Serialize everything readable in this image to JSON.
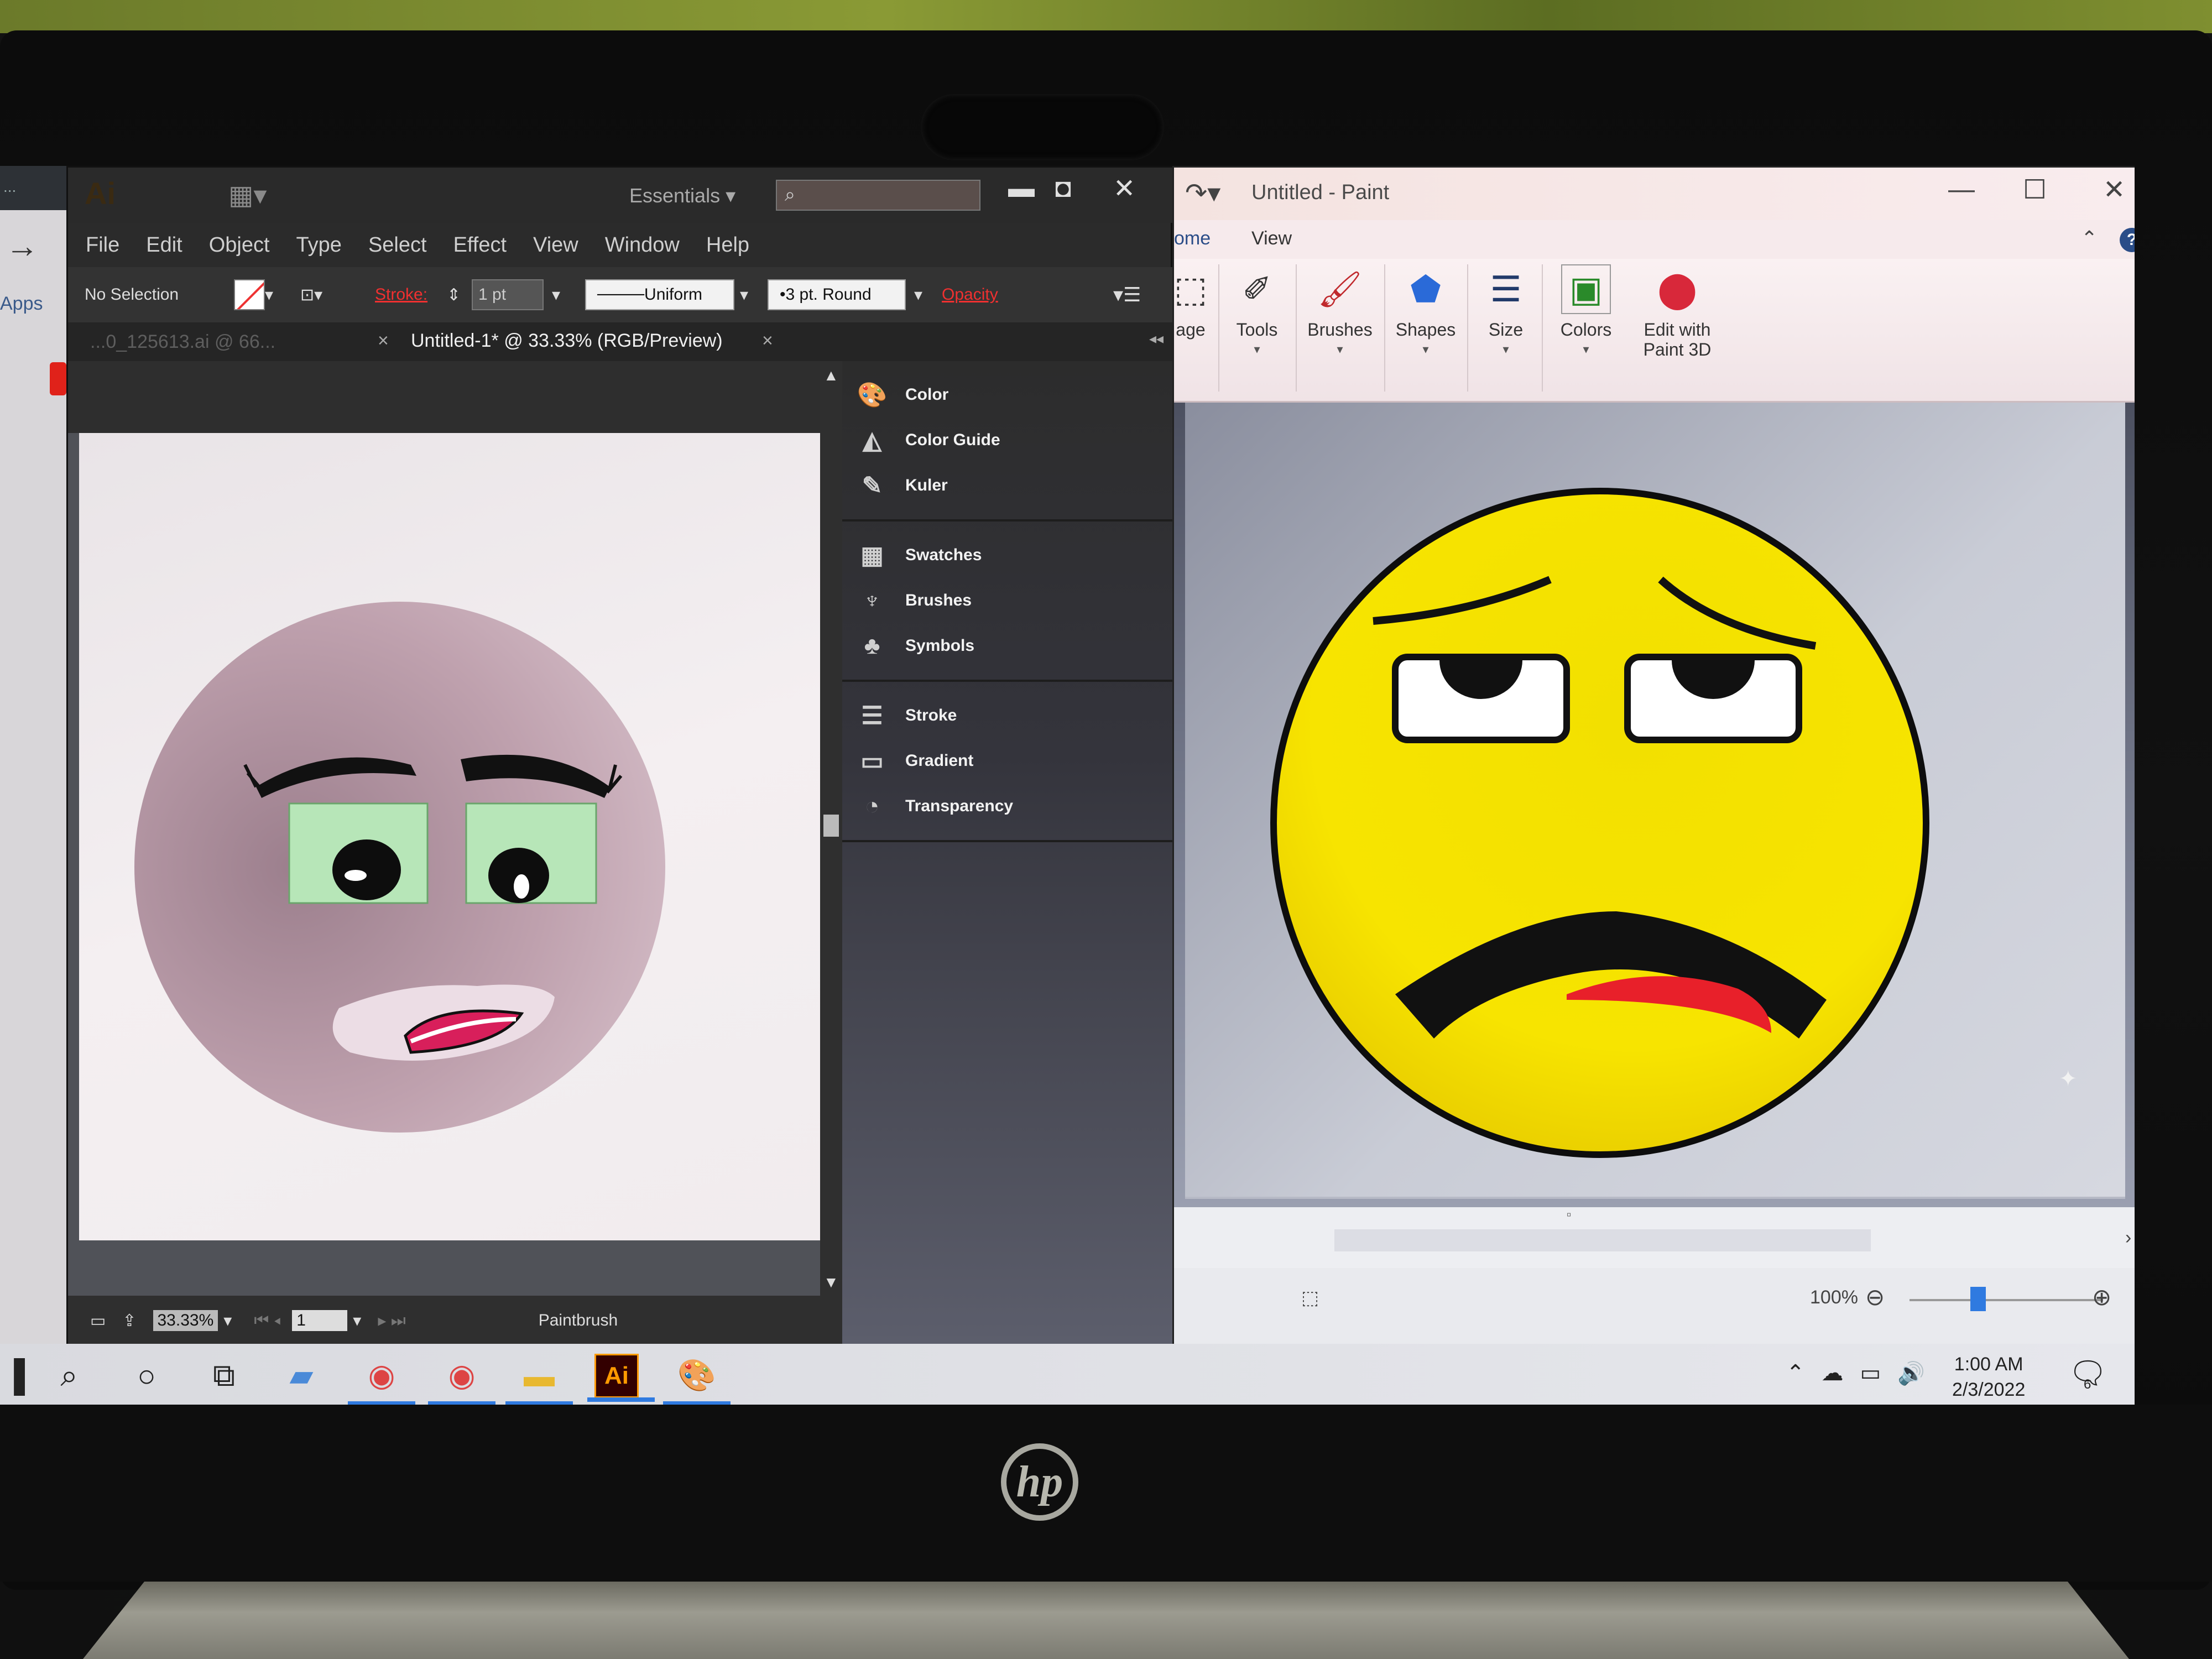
{
  "illustrator": {
    "app_logo": "Ai",
    "workspace": "Essentials",
    "workspace_arrow": "▾",
    "menu": [
      "File",
      "Edit",
      "Object",
      "Type",
      "Select",
      "Effect",
      "View",
      "Window",
      "Help"
    ],
    "control": {
      "selection": "No Selection",
      "stroke_label": "Stroke:",
      "stroke_value": "1 pt",
      "profile": "Uniform",
      "brush": "3 pt. Round",
      "opacity_label": "Opacity"
    },
    "tabs": {
      "inactive": "...0_125613.ai @ 66...",
      "active": "Untitled-1* @ 33.33% (RGB/Preview)"
    },
    "panels": [
      {
        "group": [
          {
            "label": "Color",
            "icon": "palette-icon"
          },
          {
            "label": "Color Guide",
            "icon": "color-guide-icon"
          },
          {
            "label": "Kuler",
            "icon": "kuler-icon"
          }
        ]
      },
      {
        "group": [
          {
            "label": "Swatches",
            "icon": "swatches-grid-icon"
          },
          {
            "label": "Brushes",
            "icon": "brushes-icon"
          },
          {
            "label": "Symbols",
            "icon": "symbols-club-icon"
          }
        ]
      },
      {
        "group": [
          {
            "label": "Stroke",
            "icon": "stroke-lines-icon"
          },
          {
            "label": "Gradient",
            "icon": "gradient-icon"
          },
          {
            "label": "Transparency",
            "icon": "transparency-icon"
          }
        ]
      }
    ],
    "status": {
      "zoom": "33.33%",
      "page": "1",
      "tool": "Paintbrush"
    },
    "colors": {
      "lid_green": "#b7e6b8",
      "face_mauve": "#b89aa6",
      "lip_pink": "#d81f5b"
    }
  },
  "paint": {
    "title": "Untitled - Paint",
    "tabs": [
      "ome",
      "View"
    ],
    "ribbon": [
      {
        "label": "age",
        "icon": "image-icon"
      },
      {
        "label": "Tools",
        "icon": "tools-icon"
      },
      {
        "label": "Brushes",
        "icon": "brush-icon"
      },
      {
        "label": "Shapes",
        "icon": "shapes-icon"
      },
      {
        "label": "Size",
        "icon": "size-icon"
      },
      {
        "label": "Colors",
        "icon": "colors-icon"
      },
      {
        "label": "Edit with\nPaint 3D",
        "icon": "paint3d-icon"
      }
    ],
    "zoom": "100%",
    "colors": {
      "face_yellow": "#f7e200",
      "mouth_red": "#e8202a"
    }
  },
  "left_peek": {
    "apps": "Apps"
  },
  "taskbar": {
    "time": "1:00 AM",
    "date": "2/3/2022",
    "notifications": "6",
    "pinned": [
      "search-icon",
      "cortana-icon",
      "task-view-icon",
      "app-icon",
      "chrome-icon",
      "chrome-profile-icon",
      "file-explorer-icon",
      "illustrator-icon",
      "paint-icon"
    ],
    "ai_label": "Ai"
  },
  "brand": {
    "laptop": "hp"
  }
}
